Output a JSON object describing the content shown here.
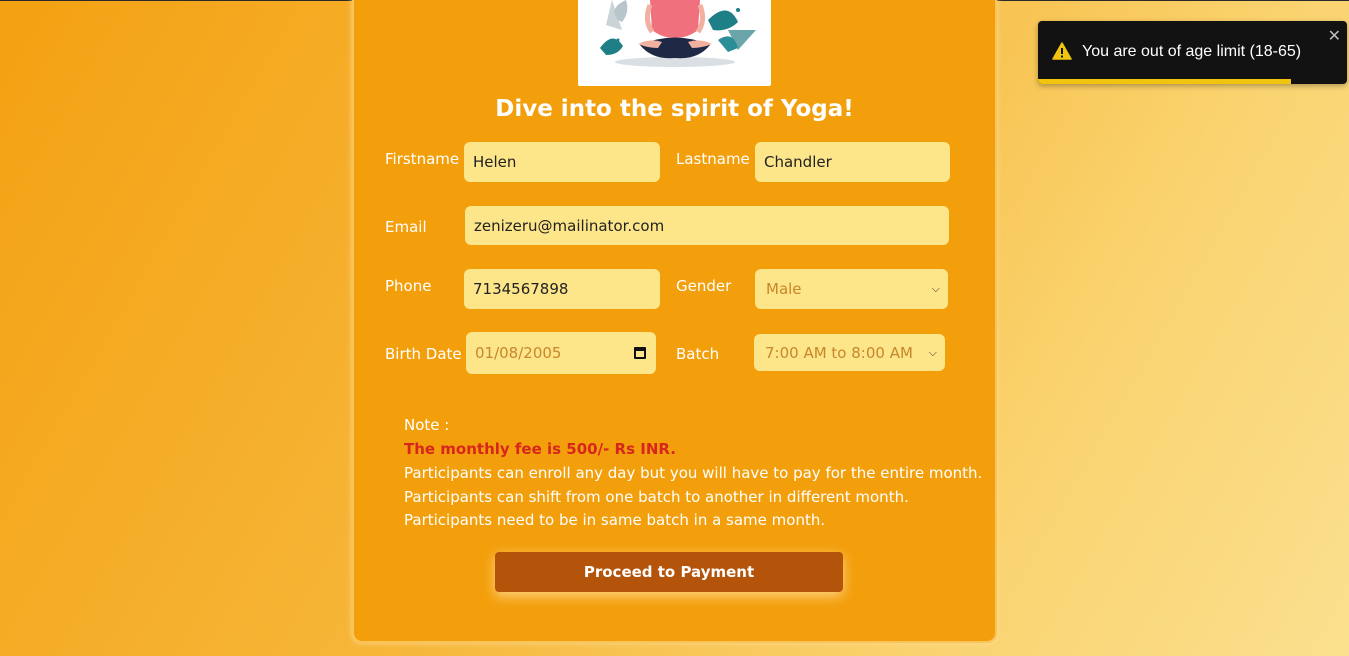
{
  "form": {
    "heading": "Dive into the spirit of Yoga!",
    "firstname": {
      "label": "Firstname",
      "value": "Helen"
    },
    "lastname": {
      "label": "Lastname",
      "value": "Chandler"
    },
    "email": {
      "label": "Email",
      "value": "zenizeru@mailinator.com"
    },
    "phone": {
      "label": "Phone",
      "value": "7134567898"
    },
    "gender": {
      "label": "Gender",
      "value": "Male"
    },
    "birthdate": {
      "label": "Birth Date",
      "value": "01/08/2005"
    },
    "batch": {
      "label": "Batch",
      "value": "7:00 AM to 8:00 AM"
    },
    "submit_label": "Proceed to Payment"
  },
  "note": {
    "title": "Note :",
    "fee": "The monthly fee is 500/- Rs INR.",
    "lines": [
      "Participants can enroll any day but you will have to pay for the entire month.",
      "Participants can shift from one batch to another in different month.",
      "Participants need to be in same batch in a same month."
    ]
  },
  "toast": {
    "message": "You are out of age limit (18-65)",
    "close": "✕",
    "icon": "warning-icon",
    "progress": 0.82
  },
  "colors": {
    "card": "#f39f0c",
    "field": "#fde58a",
    "button": "#b4540b",
    "fee_text": "#d7261e",
    "toast_bar": "#f1c40f"
  }
}
